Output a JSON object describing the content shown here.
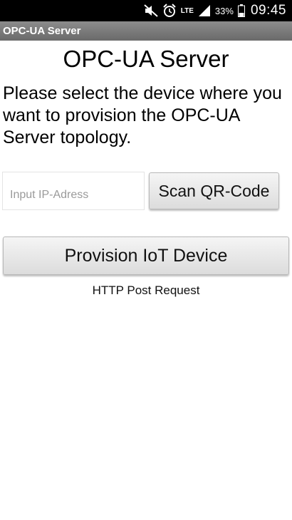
{
  "status_bar": {
    "icons": [
      "mute-icon",
      "alarm-icon",
      "lte-icon",
      "signal-icon",
      "battery-icon"
    ],
    "lte_label": "LTE",
    "battery_percent": "33%",
    "time": "09:45"
  },
  "app_bar": {
    "title": "OPC-UA Server"
  },
  "main": {
    "heading": "OPC-UA Server",
    "instructions": "Please select the device where you want to provision the OPC-UA Server topology.",
    "ip_input": {
      "value": "",
      "placeholder": "Input IP-Adress"
    },
    "scan_button_label": "Scan QR-Code",
    "provision_button_label": "Provision IoT Device",
    "status_caption": "HTTP Post Request"
  }
}
